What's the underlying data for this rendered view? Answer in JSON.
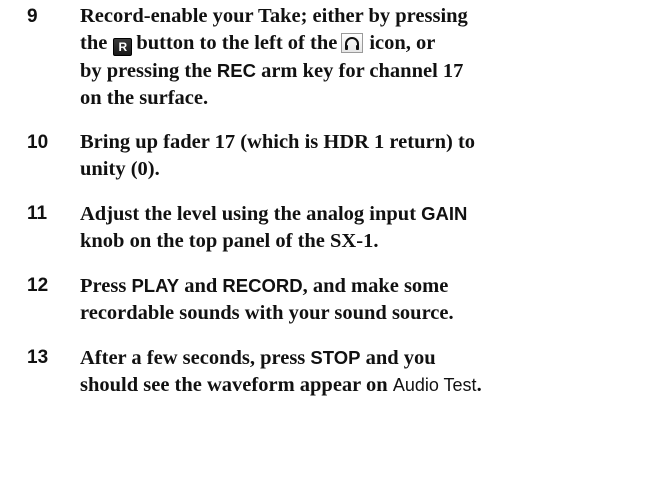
{
  "steps": [
    {
      "num": "9",
      "line1_a": "Record-enable your Take; either by pressing",
      "line2_a": "the",
      "rec_button_label": "R",
      "line2_b": "button to the left of the",
      "line2_c": "icon, or",
      "line3_a": "by pressing the",
      "rec_key": "REC",
      "line3_b": "arm key for channel 17",
      "line4": "on the surface.",
      "headphone_icon": "headphone-icon"
    },
    {
      "num": "10",
      "line1": "Bring up fader 17 (which is HDR 1 return) to",
      "line2": "unity (0)."
    },
    {
      "num": "11",
      "line1_a": "Adjust the level using the analog input",
      "gain": "GAIN",
      "line2": "knob on the top panel of the SX-1."
    },
    {
      "num": "12",
      "line1_a": "Press",
      "play": "PLAY",
      "and": "and",
      "record": "RECORD",
      "line1_b": ", and make some",
      "line2": "recordable sounds with your sound source."
    },
    {
      "num": "13",
      "line1_a": "After a few seconds, press",
      "stop": "STOP",
      "line1_b": "and you",
      "line2_a": "should see the waveform appear on",
      "audio_test": "Audio Test",
      "period": "."
    }
  ]
}
